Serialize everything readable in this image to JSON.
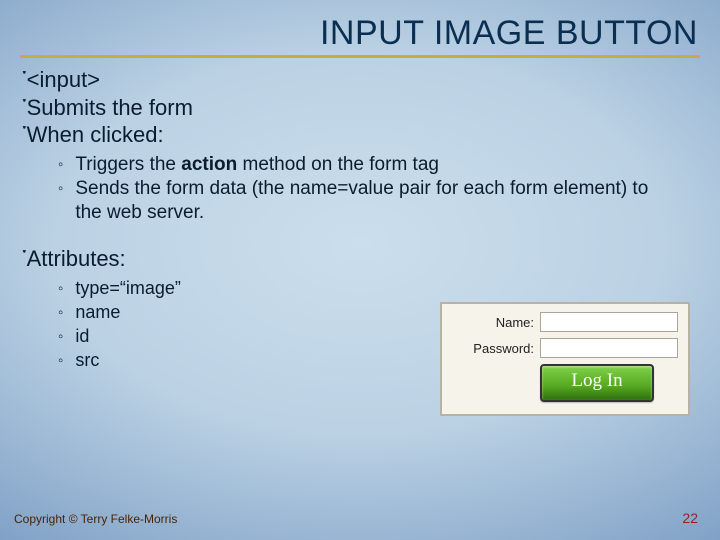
{
  "title": "INPUT IMAGE BUTTON",
  "bullets": {
    "b1": "<input>",
    "b2": "Submits the form",
    "b3": "When clicked:",
    "sub3a_pre": "Triggers the ",
    "sub3a_bold": "action",
    "sub3a_post": " method on the form tag",
    "sub3b": "Sends the form data (the name=value pair for each form element) to the web server.",
    "b4": "Attributes:",
    "attr1": "type=“image”",
    "attr2": "name",
    "attr3": "id",
    "attr4": "src"
  },
  "form": {
    "name_label": "Name:",
    "password_label": "Password:",
    "login": "Log In"
  },
  "footer": {
    "copyright": "Copyright © Terry Felke-Morris",
    "page": "22"
  },
  "glyphs": {
    "main_bullet": "་",
    "sub_bullet": "◦"
  }
}
